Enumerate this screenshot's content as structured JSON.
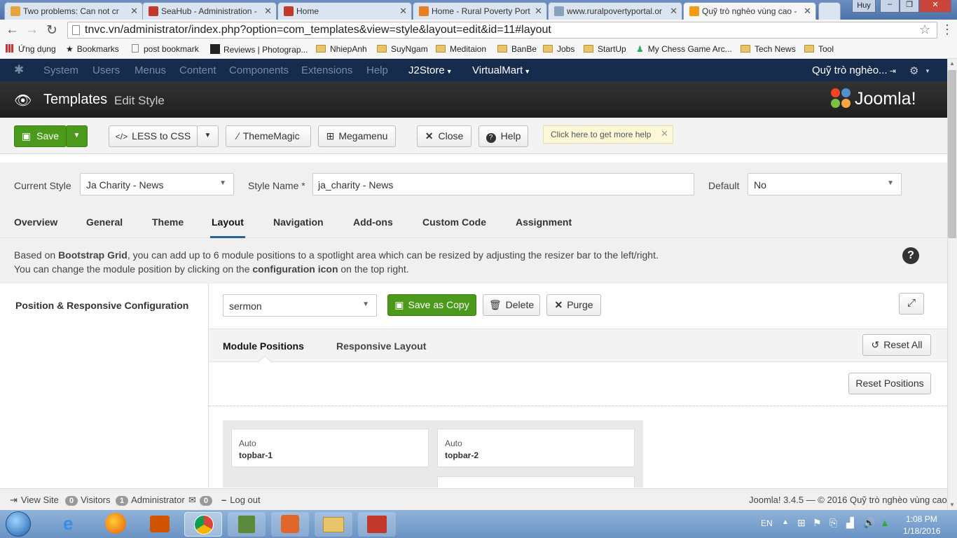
{
  "browser": {
    "tabs": [
      {
        "label": "Two problems: Can not cr"
      },
      {
        "label": "SeaHub - Administration -"
      },
      {
        "label": "Home"
      },
      {
        "label": "Home - Rural Poverty Port"
      },
      {
        "label": "www.ruralpovertyportal.or"
      },
      {
        "label": "Quỹ trò nghèo vùng cao -"
      }
    ],
    "user_label": "Huy",
    "url": "tnvc.vn/administrator/index.php?option=com_templates&view=style&layout=edit&id=11#layout",
    "bookmarks": [
      "Ứng dụng",
      "Bookmarks",
      "post bookmark",
      "Reviews | Photograp...",
      "NhiepAnh",
      "SuyNgam",
      "Meditaion",
      "BanBe",
      "Jobs",
      "StartUp",
      "My Chess Game Arc...",
      "Tech News",
      "Tool"
    ]
  },
  "admin_nav": {
    "items": [
      "System",
      "Users",
      "Menus",
      "Content",
      "Components",
      "Extensions",
      "Help"
    ],
    "menus": [
      "J2Store",
      "VirtualMart"
    ],
    "site_name": "Quỹ trò nghèo..."
  },
  "header": {
    "title": "Templates",
    "subtitle": "Edit Style",
    "logo_text": "Joomla!"
  },
  "toolbar": {
    "save": "Save",
    "less_to_css": "LESS to CSS",
    "thememagic": "ThemeMagic",
    "megamenu": "Megamenu",
    "close": "Close",
    "help": "Help",
    "tooltip": "Click here to get more help"
  },
  "form": {
    "current_style_label": "Current Style",
    "current_style_value": "Ja Charity - News",
    "style_name_label": "Style Name *",
    "style_name_value": "ja_charity - News",
    "default_label": "Default",
    "default_value": "No"
  },
  "tabs": [
    "Overview",
    "General",
    "Theme",
    "Layout",
    "Navigation",
    "Add-ons",
    "Custom Code",
    "Assignment"
  ],
  "info": {
    "line1_pre": "Based on ",
    "line1_bold": "Bootstrap Grid",
    "line1_post": ", you can add up to 6 module positions to a spotlight area which can be resized by adjusting the resizer bar to the left/right.",
    "line2_pre": "You can change the module position by clicking on the ",
    "line2_bold": "configuration icon",
    "line2_post": " on the top right."
  },
  "layout": {
    "side_title": "Position & Responsive Configuration",
    "layout_select": "sermon",
    "save_as_copy": "Save as Copy",
    "delete": "Delete",
    "purge": "Purge",
    "subtab_positions": "Module Positions",
    "subtab_responsive": "Responsive Layout",
    "reset_all": "Reset All",
    "reset_positions": "Reset Positions",
    "cells": [
      {
        "width": "Auto",
        "name": "topbar-1"
      },
      {
        "width": "Auto",
        "name": "topbar-2"
      }
    ]
  },
  "footer": {
    "view_site": "View Site",
    "visitors_count": "0",
    "visitors": "Visitors",
    "admins_count": "1",
    "admins": "Administrator",
    "messages_count": "0",
    "logout": "Log out",
    "copyright": "Joomla! 3.4.5  —  © 2016 Quỹ trò nghèo vùng cao"
  },
  "taskbar": {
    "lang": "EN",
    "time": "1:08 PM",
    "date": "1/18/2016"
  },
  "colors": {
    "admin_nav": "#162c4d",
    "header": "#1f1f1f",
    "save_green": "#4c9a1c",
    "active_tab": "#2a6496"
  }
}
